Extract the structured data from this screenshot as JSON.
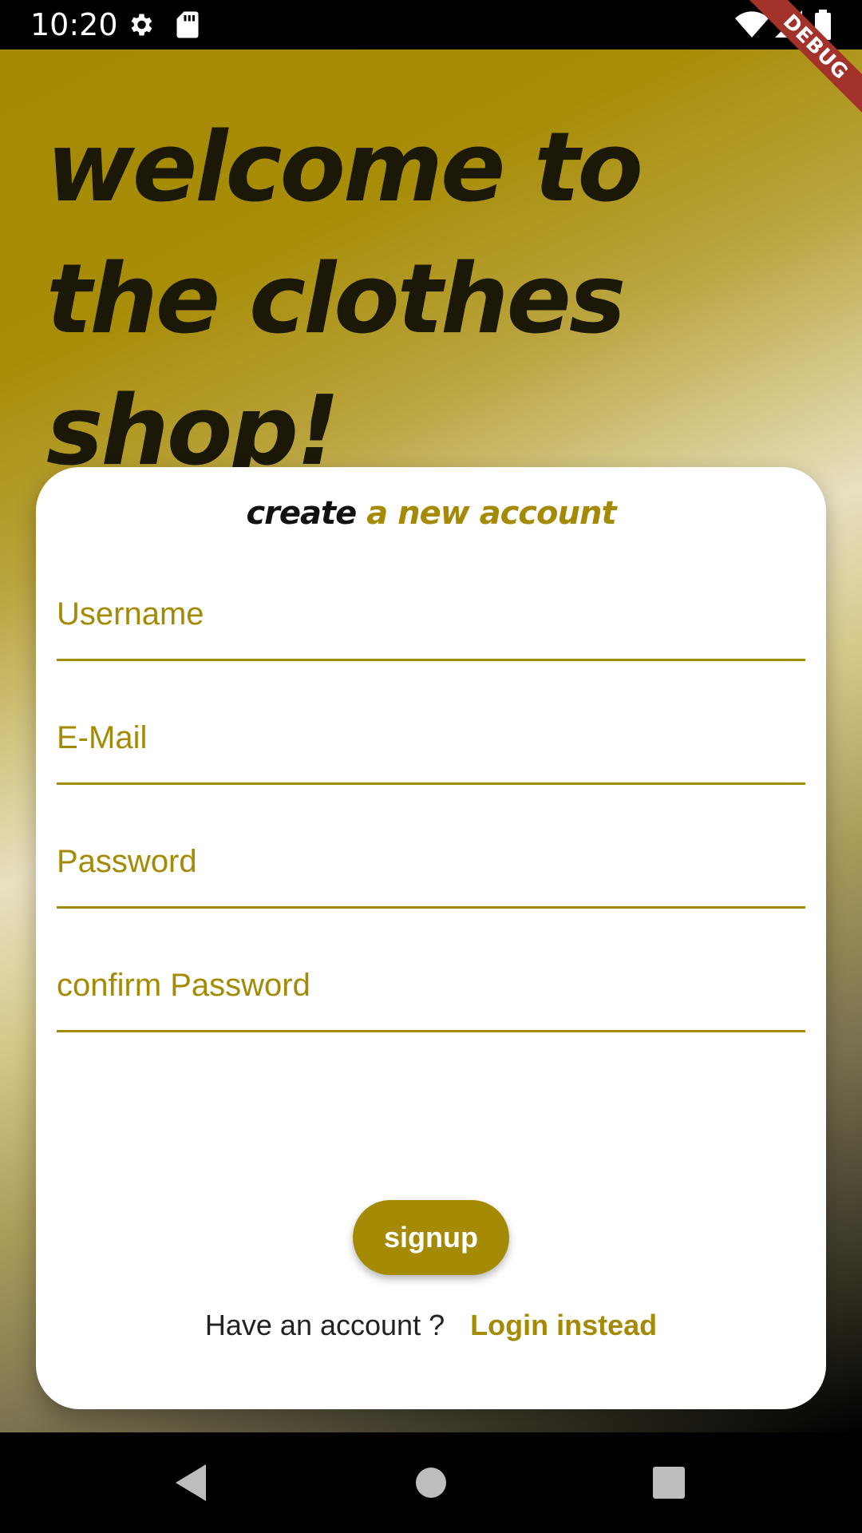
{
  "status_bar": {
    "time": "10:20",
    "icons": [
      "gear-icon",
      "sdcard-icon",
      "wifi-icon",
      "signal-icon",
      "battery-icon"
    ]
  },
  "debug_banner": {
    "label": "DEBUG",
    "color": "#a3322a"
  },
  "hero": {
    "title": "welcome to the clothes shop!"
  },
  "card": {
    "heading_part1": "create",
    "heading_part2": "a new account",
    "fields": [
      {
        "label": "Username",
        "value": ""
      },
      {
        "label": "E-Mail",
        "value": ""
      },
      {
        "label": "Password",
        "value": ""
      },
      {
        "label": "confirm Password",
        "value": ""
      }
    ],
    "signup_label": "signup",
    "login_question": "Have an account ?",
    "login_link": "Login instead"
  },
  "colors": {
    "accent": "#a48a05",
    "title_text": "#1b1808",
    "card_bg": "#ffffff"
  },
  "nav_bar": {
    "buttons": [
      "back-icon",
      "home-icon",
      "recents-icon"
    ]
  }
}
